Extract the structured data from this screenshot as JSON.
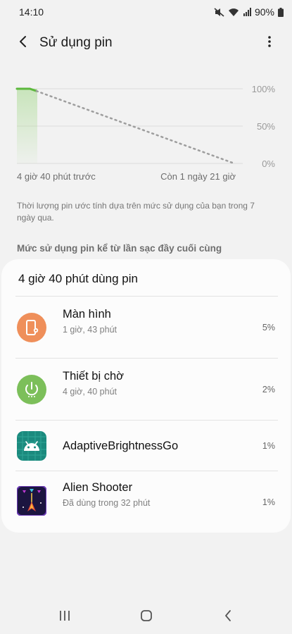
{
  "status_bar": {
    "time": "14:10",
    "battery_percent": "90%",
    "icons": [
      "mute-icon",
      "wifi-icon",
      "signal-icon",
      "battery-icon"
    ]
  },
  "app_bar": {
    "title": "Sử dụng pin",
    "back_icon": "back-arrow-icon",
    "more_icon": "more-vertical-icon"
  },
  "chart_data": {
    "type": "line",
    "title": "",
    "y_ticks": [
      "100%",
      "50%",
      "0%"
    ],
    "x_ticks": [
      "4 giờ 40 phút trước",
      "Còn 1 ngày 21 giờ"
    ],
    "ylim": [
      0,
      100
    ],
    "series": [
      {
        "style": "solid",
        "color": "#5cb83c",
        "points": [
          {
            "x": 0,
            "y": 100
          },
          {
            "x": 0.06,
            "y": 100
          },
          {
            "x": 0.09,
            "y": 97
          }
        ]
      },
      {
        "style": "dotted",
        "color": "#9e9e9e",
        "points": [
          {
            "x": 0.09,
            "y": 97
          },
          {
            "x": 1,
            "y": 0
          }
        ]
      }
    ],
    "grid": true
  },
  "chart_description": "Thời lượng pin ước tính dựa trên mức sử dụng của bạn trong 7 ngày qua.",
  "section_header": "Mức sử dụng pin kể từ lần sạc đầy cuối cùng",
  "usage_card": {
    "title": "4 giờ 40 phút dùng pin",
    "items": [
      {
        "name": "Màn hình",
        "sub": "1 giờ, 43 phút",
        "percent": "5%",
        "icon": "screen-icon",
        "icon_color": "#ef8f5a"
      },
      {
        "name": "Thiết bị chờ",
        "sub": "4 giờ, 40 phút",
        "percent": "2%",
        "icon": "standby-power-icon",
        "icon_color": "#7cbf5a"
      },
      {
        "name": "AdaptiveBrightnessGo",
        "sub": "",
        "percent": "1%",
        "icon": "android-icon",
        "icon_color": "#1b8a7e"
      },
      {
        "name": "Alien Shooter",
        "sub": "Đã dùng trong 32 phút",
        "percent": "1%",
        "icon": "alien-shooter-game-icon",
        "icon_color": "#2a1f5a"
      }
    ]
  },
  "nav_bar": {
    "recents_icon": "recents-icon",
    "home_icon": "home-icon",
    "back_icon": "nav-back-icon"
  }
}
